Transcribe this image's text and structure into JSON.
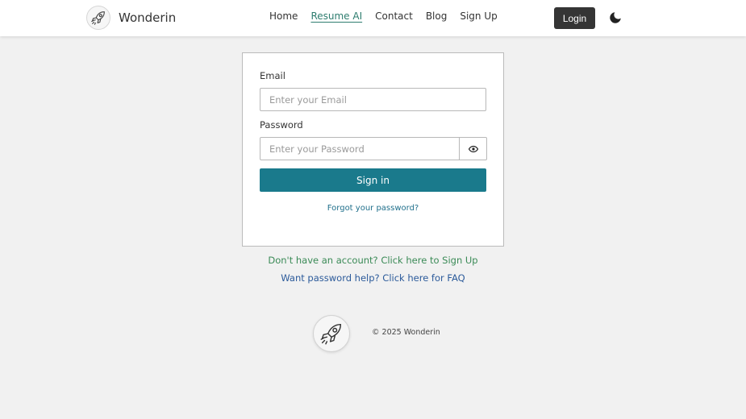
{
  "brand": {
    "name": "Wonderin",
    "logo_icon": "rocket-icon"
  },
  "nav": {
    "links": [
      {
        "label": "Home",
        "active": false
      },
      {
        "label": "Resume AI",
        "active": true
      },
      {
        "label": "Contact",
        "active": false
      },
      {
        "label": "Blog",
        "active": false
      },
      {
        "label": "Sign Up",
        "active": false
      }
    ],
    "login_label": "Login",
    "theme_icon": "moon-icon"
  },
  "form": {
    "email_label": "Email",
    "email_placeholder": "Enter your Email",
    "email_value": "",
    "password_label": "Password",
    "password_placeholder": "Enter your Password",
    "password_value": "",
    "show_password_icon": "eye-icon",
    "signin_label": "Sign in",
    "forgot_label": "Forgot your password?"
  },
  "links": {
    "signup_text": "Don't have an account? Click here to Sign Up",
    "faq_text": "Want password help? Click here for FAQ"
  },
  "footer": {
    "copyright": "© 2025 Wonderin",
    "logo_icon": "rocket-icon"
  },
  "colors": {
    "accent": "#1a7a8c",
    "active_nav": "#2e7d6f",
    "signup_link": "#3a8a56",
    "faq_link": "#2b5a9a",
    "login_button": "#353535"
  }
}
